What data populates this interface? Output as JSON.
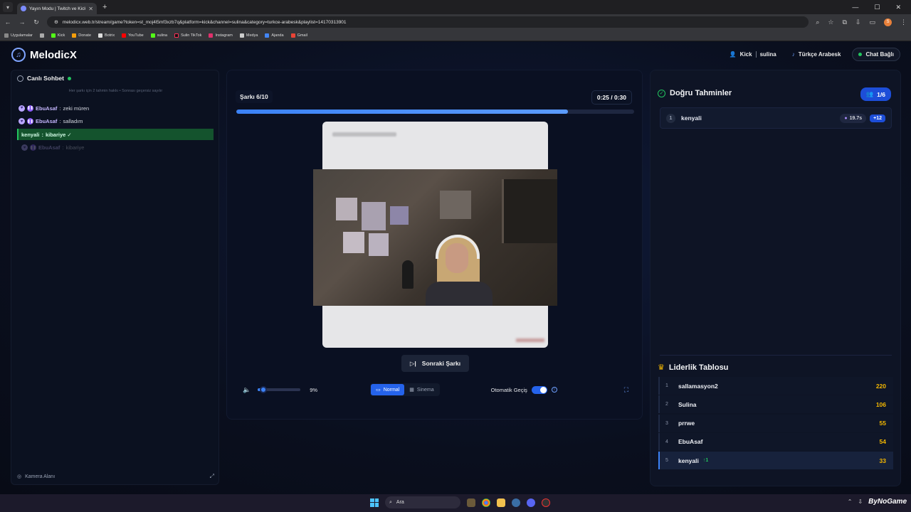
{
  "browser": {
    "tab_title": "Yayın Modu | Twitch ve Kick",
    "url": "melodicx.web.tr/stream/game?token=st_moj4l5mf3xzb7q&platform=kick&channel=sulina&category=turkce-arabesk&playlist=14170313901",
    "profile_initial": "S",
    "bookmarks": [
      "Uygulamalar",
      "Kick",
      "Donate",
      "Botrix",
      "YouTube",
      "sulina",
      "Sulin TikTok",
      "Instagram",
      "Medya",
      "Ajanda",
      "Gmail"
    ]
  },
  "header": {
    "brand": "MelodicX",
    "platform": "Kick",
    "channel": "sulina",
    "category": "Türkçe Arabesk",
    "chat_status": "Chat Bağlı"
  },
  "chat": {
    "title": "Canlı Sohbet",
    "subtitle": "Her şarkı için 2 tahmin hakkı • Sonrası geçersiz sayılır",
    "messages": [
      {
        "user": "EbuAsaf",
        "text": "zeki müren"
      },
      {
        "user": "EbuAsaf",
        "text": "salladım"
      },
      {
        "user": "kenyali",
        "text": "kibariye ✓"
      },
      {
        "user": "EbuAsaf",
        "text": "kibariye"
      }
    ],
    "camera_label": "Kamera Alanı"
  },
  "player": {
    "song_counter": "Şarkı 6/10",
    "time_current": "0:25",
    "time_sep": "/",
    "time_total": "0:30",
    "progress": 0.8333,
    "next_label": "Sonraki Şarkı",
    "volume_percent": "9%",
    "volume_value": 0.09,
    "mode_normal": "Normal",
    "mode_cinema": "Sinema",
    "auto_label": "Otomatik Geçiş",
    "auto_enabled": true
  },
  "guesses": {
    "title": "Doğru Tahminler",
    "count": "1/6",
    "items": [
      {
        "rank": "1",
        "name": "kenyali",
        "time": "19.7s",
        "points": "+12"
      }
    ]
  },
  "leaderboard": {
    "title": "Liderlik Tablosu",
    "rows": [
      {
        "rank": "1",
        "name": "sallamasyon2",
        "score": "220"
      },
      {
        "rank": "2",
        "name": "Sulina",
        "score": "106"
      },
      {
        "rank": "3",
        "name": "prrwe",
        "score": "55"
      },
      {
        "rank": "4",
        "name": "EbuAsaf",
        "score": "54"
      },
      {
        "rank": "5",
        "name": "kenyali",
        "score": "33",
        "change": "↑1"
      }
    ]
  },
  "taskbar": {
    "search_placeholder": "Ara",
    "watermark": "ByNoGame"
  },
  "colors": {
    "accent": "#3b82f6",
    "success": "#22c55e",
    "gold": "#f5b800",
    "background": "#0b0f1c"
  }
}
